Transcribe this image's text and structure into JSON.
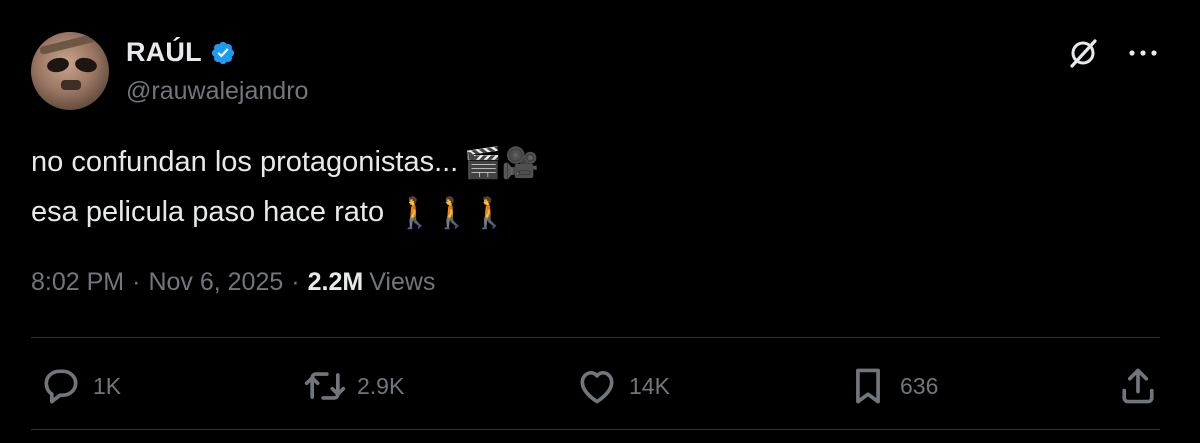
{
  "author": {
    "name": "RAÚL",
    "handle": "@rauwalejandro",
    "verified": true
  },
  "tweet": {
    "line1": "no confundan los protagonistas...",
    "line1_emojis": "🎬🎥",
    "line2": "esa pelicula paso hace rato",
    "line2_emojis": "🚶🚶🚶"
  },
  "meta": {
    "time": "8:02 PM",
    "separator": "·",
    "date": "Nov 6, 2025",
    "views_count": "2.2M",
    "views_label": "Views"
  },
  "actions": {
    "replies": "1K",
    "retweets": "2.9K",
    "likes": "14K",
    "bookmarks": "636"
  },
  "icons": {
    "top": [
      "grok-icon",
      "more-icon"
    ],
    "actions": [
      "reply-icon",
      "retweet-icon",
      "like-icon",
      "bookmark-icon",
      "share-icon"
    ]
  },
  "colors": {
    "background": "#000000",
    "text_primary": "#e7e9ea",
    "text_secondary": "#71767b",
    "verified": "#1d9bf0",
    "divider": "#2f3336"
  }
}
